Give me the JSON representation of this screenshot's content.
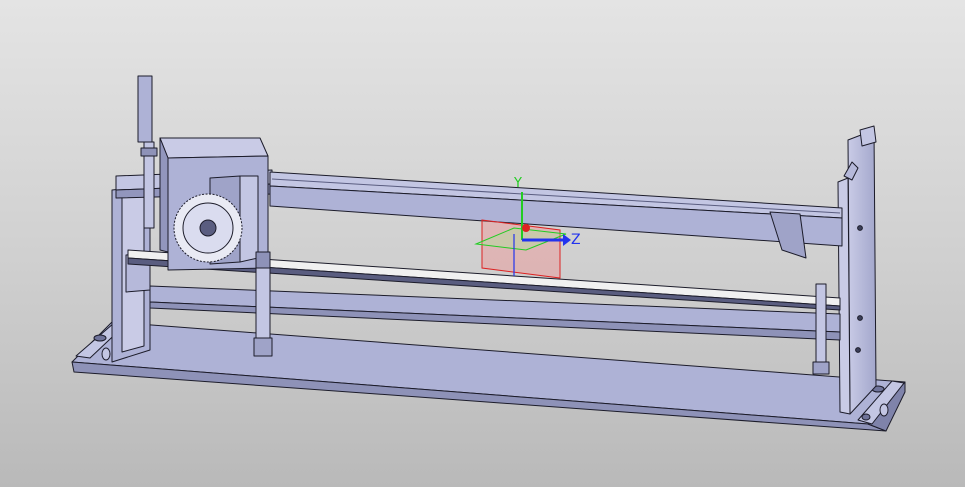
{
  "viewport": {
    "background": [
      "#e4e4e4",
      "#b9b9b9"
    ],
    "model_color": "#aeb2d6",
    "model_edge_color": "#1c1c2a"
  },
  "triad": {
    "y_label": "Y",
    "z_label": "Z",
    "y_color": "#22cc22",
    "z_color": "#2233ee",
    "x_color": "#dd2222"
  }
}
